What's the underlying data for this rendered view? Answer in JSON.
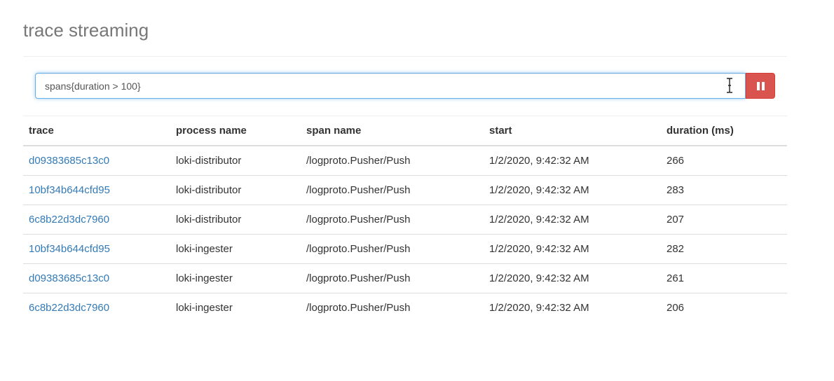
{
  "page": {
    "title": "trace streaming"
  },
  "query": {
    "value": "spans{duration > 100}"
  },
  "toolbar": {
    "pause_icon": "pause-icon",
    "pause_color": "#d9534f"
  },
  "table": {
    "columns": [
      "trace",
      "process name",
      "span name",
      "start",
      "duration (ms)"
    ],
    "rows": [
      {
        "trace": "d09383685c13c0",
        "process": "loki-distributor",
        "span": "/logproto.Pusher/Push",
        "start": "1/2/2020, 9:42:32 AM",
        "duration": "266"
      },
      {
        "trace": "10bf34b644cfd95",
        "process": "loki-distributor",
        "span": "/logproto.Pusher/Push",
        "start": "1/2/2020, 9:42:32 AM",
        "duration": "283"
      },
      {
        "trace": "6c8b22d3dc7960",
        "process": "loki-distributor",
        "span": "/logproto.Pusher/Push",
        "start": "1/2/2020, 9:42:32 AM",
        "duration": "207"
      },
      {
        "trace": "10bf34b644cfd95",
        "process": "loki-ingester",
        "span": "/logproto.Pusher/Push",
        "start": "1/2/2020, 9:42:32 AM",
        "duration": "282"
      },
      {
        "trace": "d09383685c13c0",
        "process": "loki-ingester",
        "span": "/logproto.Pusher/Push",
        "start": "1/2/2020, 9:42:32 AM",
        "duration": "261"
      },
      {
        "trace": "6c8b22d3dc7960",
        "process": "loki-ingester",
        "span": "/logproto.Pusher/Push",
        "start": "1/2/2020, 9:42:32 AM",
        "duration": "206"
      }
    ]
  }
}
